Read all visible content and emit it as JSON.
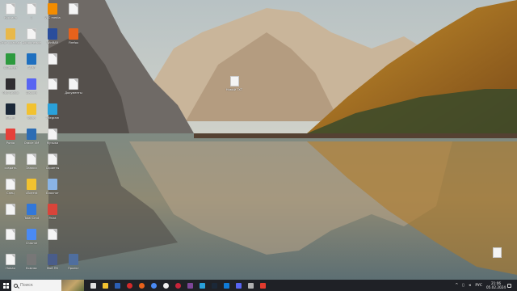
{
  "desktop": {
    "grid_icons": [
      {
        "label": "Корзина",
        "kind": "doc",
        "color": "#f4f4f4"
      },
      {
        "label": "1",
        "kind": "doc",
        "color": "#f4f4f4"
      },
      {
        "label": "VLC media",
        "kind": "app",
        "color": "#f28c00"
      },
      {
        "label": "",
        "kind": "doc",
        "color": "#f4f4f4"
      },
      {
        "label": "Этот компьютер",
        "kind": "app",
        "color": "#e8b84a"
      },
      {
        "label": "Дополнение",
        "kind": "doc",
        "color": "#f4f4f4"
      },
      {
        "label": "WinRAR",
        "kind": "app",
        "color": "#2a4d9b"
      },
      {
        "label": "Firefox",
        "kind": "app",
        "color": "#e8621b"
      },
      {
        "label": "CCleaner",
        "kind": "app",
        "color": "#2c9a3e"
      },
      {
        "label": "AIMP",
        "kind": "app",
        "color": "#1e6fbf"
      },
      {
        "label": "",
        "kind": "doc",
        "color": "#f4f4f4"
      },
      {
        "label": "",
        "kind": "empty",
        "color": ""
      },
      {
        "label": "OBS Studio",
        "kind": "app",
        "color": "#302e31"
      },
      {
        "label": "Discord",
        "kind": "app",
        "color": "#5865f2"
      },
      {
        "label": "",
        "kind": "doc",
        "color": "#f4f4f4"
      },
      {
        "label": "Документы",
        "kind": "doc",
        "color": "#f4f4f4"
      },
      {
        "label": "Steam",
        "kind": "app",
        "color": "#1b2838"
      },
      {
        "label": "Uplay",
        "kind": "app",
        "color": "#f2c230"
      },
      {
        "label": "Telegram",
        "kind": "app",
        "color": "#2aa1da"
      },
      {
        "label": "",
        "kind": "empty",
        "color": ""
      },
      {
        "label": "Punto",
        "kind": "app",
        "color": "#e6413a"
      },
      {
        "label": "Oracle VM",
        "kind": "app",
        "color": "#2d6db4"
      },
      {
        "label": "Музыка",
        "kind": "doc",
        "color": "#f4f4f4"
      },
      {
        "label": "",
        "kind": "empty",
        "color": ""
      },
      {
        "label": "создать",
        "kind": "doc",
        "color": "#f4f4f4"
      },
      {
        "label": "Записи",
        "kind": "doc",
        "color": "#f4f4f4"
      },
      {
        "label": "Скрипты",
        "kind": "doc",
        "color": "#f4f4f4"
      },
      {
        "label": "",
        "kind": "empty",
        "color": ""
      },
      {
        "label": "Спец",
        "kind": "doc",
        "color": "#f4f4f4"
      },
      {
        "label": "uTorrent",
        "kind": "app",
        "color": "#f2c230"
      },
      {
        "label": "Блокнот",
        "kind": "app",
        "color": "#8ab4e6"
      },
      {
        "label": "",
        "kind": "empty",
        "color": ""
      },
      {
        "label": "",
        "kind": "doc",
        "color": "#f4f4f4"
      },
      {
        "label": "Total Cmd",
        "kind": "app",
        "color": "#3277d8"
      },
      {
        "label": "Paint",
        "kind": "app",
        "color": "#d9443a"
      },
      {
        "label": "",
        "kind": "empty",
        "color": ""
      },
      {
        "label": "",
        "kind": "doc",
        "color": "#f4f4f4"
      },
      {
        "label": "Chrome",
        "kind": "app",
        "color": "#4a8af4"
      },
      {
        "label": "",
        "kind": "doc",
        "color": "#f4f4f4"
      },
      {
        "label": "",
        "kind": "empty",
        "color": ""
      },
      {
        "label": "Новая",
        "kind": "doc",
        "color": "#f4f4f4"
      },
      {
        "label": "Компас",
        "kind": "app",
        "color": "#777777"
      },
      {
        "label": "Мой ПК",
        "kind": "app",
        "color": "#4a5d8a"
      },
      {
        "label": "Проект",
        "kind": "app",
        "color": "#4f6e9e"
      }
    ],
    "free_icons": [
      {
        "label": "Новый ТХТ",
        "name": "desktop-file-center"
      },
      {
        "label": "",
        "name": "desktop-file-bottom-right"
      }
    ]
  },
  "taskbar": {
    "search_placeholder": "Поиск",
    "apps": [
      {
        "name": "task-view",
        "color": "#e0e0e0"
      },
      {
        "name": "explorer",
        "color": "#f2c230"
      },
      {
        "name": "word",
        "color": "#2b5fb4"
      },
      {
        "name": "opera",
        "color": "#d42a2a"
      },
      {
        "name": "firefox",
        "color": "#e8621b"
      },
      {
        "name": "chrome",
        "color": "#4a8af4"
      },
      {
        "name": "yandex",
        "color": "#f0f0f0"
      },
      {
        "name": "opera-gx",
        "color": "#c8243a"
      },
      {
        "name": "tor",
        "color": "#7d4698"
      },
      {
        "name": "telegram",
        "color": "#2aa1da"
      },
      {
        "name": "steam",
        "color": "#1b2838"
      },
      {
        "name": "edge",
        "color": "#0f7bd7"
      },
      {
        "name": "discord",
        "color": "#5865f2"
      },
      {
        "name": "settings",
        "color": "#b0b0b0"
      },
      {
        "name": "pdf",
        "color": "#e23b2e"
      }
    ],
    "tray": {
      "language": "РУС",
      "time": "21:06",
      "date": "05.02.2024"
    }
  }
}
